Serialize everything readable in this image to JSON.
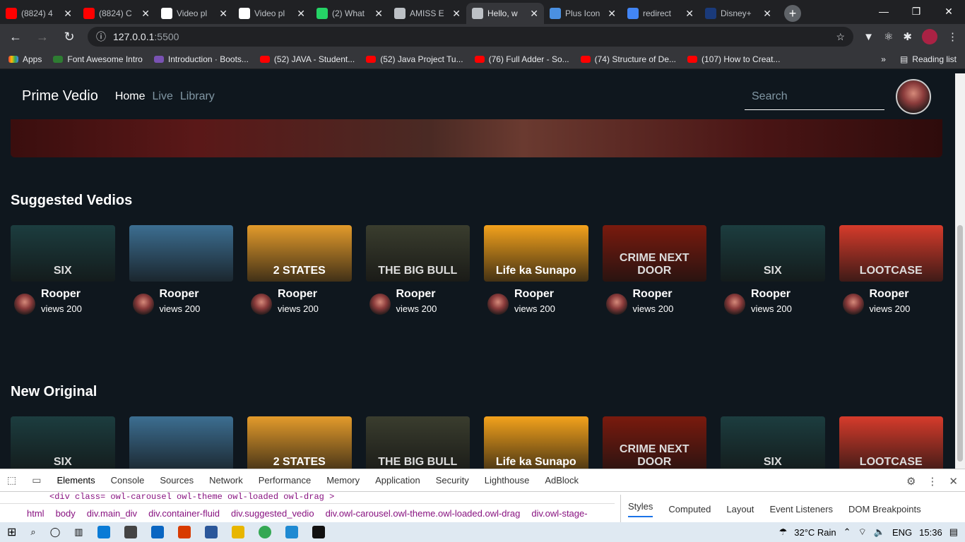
{
  "browser": {
    "tabs": [
      {
        "title": "(8824) 4",
        "color": "#ff0000"
      },
      {
        "title": "(8824) C",
        "color": "#ff0000"
      },
      {
        "title": "Video pl",
        "color": "#ffffff"
      },
      {
        "title": "Video pl",
        "color": "#ffffff"
      },
      {
        "title": "(2) What",
        "color": "#25d366"
      },
      {
        "title": "AMISS E",
        "color": "#bdc1c6"
      },
      {
        "title": "Hello, w",
        "color": "#bdc1c6"
      },
      {
        "title": "Plus Icon",
        "color": "#4a90e2"
      },
      {
        "title": "redirect",
        "color": "#4285f4"
      },
      {
        "title": "Disney+",
        "color": "#1a3a7a"
      }
    ],
    "active_tab_index": 6,
    "url_host": "127.0.0.1",
    "url_port": ":5500",
    "bookmarks": [
      {
        "label": "Apps"
      },
      {
        "label": "Font Awesome Intro"
      },
      {
        "label": "Introduction · Boots..."
      },
      {
        "label": "(52) JAVA - Student..."
      },
      {
        "label": "(52) Java Project Tu..."
      },
      {
        "label": "(76) Full Adder - So..."
      },
      {
        "label": "(74) Structure of De..."
      },
      {
        "label": "(107) How to Creat..."
      }
    ],
    "reading_list": "Reading list",
    "more": "»"
  },
  "site": {
    "brand": "Prime Vedio",
    "nav": [
      "Home",
      "Live",
      "Library"
    ],
    "search_placeholder": "Search",
    "sections": [
      {
        "title": "Suggested Vedios",
        "cards": [
          {
            "thumb": "SIX",
            "bg": "#1c3d3f",
            "name": "Rooper",
            "views": "views 200"
          },
          {
            "thumb": "",
            "bg": "#3c6e91",
            "name": "Rooper",
            "views": "views 200"
          },
          {
            "thumb": "2 STATES",
            "bg": "#e39b2b",
            "name": "Rooper",
            "views": "views 200"
          },
          {
            "thumb": "THE BIG BULL",
            "bg": "#3a3d2e",
            "name": "Rooper",
            "views": "views 200"
          },
          {
            "thumb": "Life ka Sunapo",
            "bg": "#f3a21c",
            "name": "Rooper",
            "views": "views 200"
          },
          {
            "thumb": "CRIME NEXT DOOR",
            "bg": "#7a1a0e",
            "name": "Rooper",
            "views": "views 200"
          },
          {
            "thumb": "SIX",
            "bg": "#1c3d3f",
            "name": "Rooper",
            "views": "views 200"
          },
          {
            "thumb": "LOOTCASE",
            "bg": "#d63b2b",
            "name": "Rooper",
            "views": "views 200"
          }
        ]
      },
      {
        "title": "New Original",
        "cards": [
          {
            "thumb": "SIX",
            "bg": "#1c3d3f"
          },
          {
            "thumb": "",
            "bg": "#3c6e91"
          },
          {
            "thumb": "2 STATES",
            "bg": "#e39b2b"
          },
          {
            "thumb": "THE BIG BULL",
            "bg": "#3a3d2e"
          },
          {
            "thumb": "Life ka Sunapo",
            "bg": "#f3a21c"
          },
          {
            "thumb": "CRIME NEXT DOOR",
            "bg": "#7a1a0e"
          },
          {
            "thumb": "SIX",
            "bg": "#1c3d3f"
          },
          {
            "thumb": "LOOTCASE",
            "bg": "#d63b2b"
          }
        ]
      }
    ]
  },
  "devtools": {
    "tabs": [
      "Elements",
      "Console",
      "Sources",
      "Network",
      "Performance",
      "Memory",
      "Application",
      "Security",
      "Lighthouse",
      "AdBlock"
    ],
    "code_line": "<div class= owl-carousel owl-theme owl-loaded owl-drag >",
    "breadcrumbs": [
      "html",
      "body",
      "div.main_div",
      "div.container-fluid",
      "div.suggested_vedio",
      "div.owl-carousel.owl-theme.owl-loaded.owl-drag",
      "div.owl-stage-"
    ],
    "styles_tabs": [
      "Styles",
      "Computed",
      "Layout",
      "Event Listeners",
      "DOM Breakpoints"
    ]
  },
  "taskbar": {
    "weather": "32°C  Rain",
    "lang": "ENG",
    "time": "15:36"
  }
}
